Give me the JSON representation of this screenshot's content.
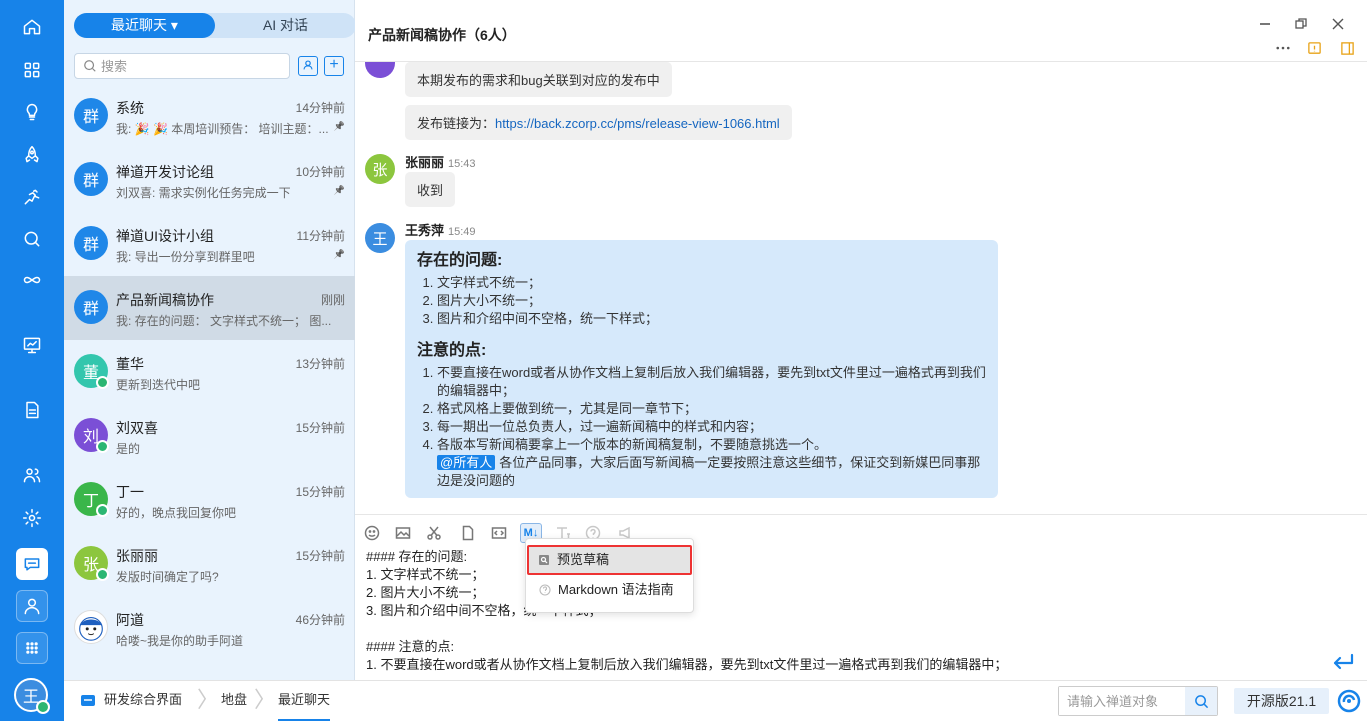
{
  "rail": {
    "items": [
      "home-icon",
      "apps-grid-icon",
      "bulb-icon",
      "rocket-icon",
      "running-icon",
      "search-icon",
      "infinity-icon",
      "board-icon",
      "document-icon",
      "contacts-icon",
      "settings-icon",
      "chat-icon",
      "user-icon",
      "more-apps-icon"
    ],
    "active": "chat-icon",
    "user_avatar": "王"
  },
  "list": {
    "tabs": [
      "最近聊天 ▾",
      "AI 对话"
    ],
    "active_tab": 0,
    "search_placeholder": "搜索",
    "conversations": [
      {
        "avatar": "群",
        "color": "#1f87e8",
        "name": "系统",
        "time": "14分钟前",
        "preview": "我: 🎉 🎉 本周培训预告： 培训主题：...",
        "pinned": true,
        "online": false
      },
      {
        "avatar": "群",
        "color": "#1f87e8",
        "name": "禅道开发讨论组",
        "time": "10分钟前",
        "preview": "刘双喜: 需求实例化任务完成一下",
        "pinned": true,
        "online": false
      },
      {
        "avatar": "群",
        "color": "#1f87e8",
        "name": "禅道UI设计小组",
        "time": "11分钟前",
        "preview": "我: 导出一份分享到群里吧",
        "pinned": true,
        "online": false
      },
      {
        "avatar": "群",
        "color": "#1f87e8",
        "name": "产品新闻稿协作",
        "time": "刚刚",
        "preview": "我: 存在的问题： 文字样式不统一； 图...",
        "pinned": false,
        "online": false,
        "selected": true
      },
      {
        "avatar": "董",
        "color": "#33c6ad",
        "name": "董华",
        "time": "13分钟前",
        "preview": "更新到迭代中吧",
        "pinned": false,
        "online": true
      },
      {
        "avatar": "刘",
        "color": "#7b4fd6",
        "name": "刘双喜",
        "time": "15分钟前",
        "preview": "是的",
        "pinned": false,
        "online": true
      },
      {
        "avatar": "丁",
        "color": "#3ab64a",
        "name": "丁一",
        "time": "15分钟前",
        "preview": "好的，晚点我回复你吧",
        "pinned": false,
        "online": true
      },
      {
        "avatar": "张",
        "color": "#8cc63e",
        "name": "张丽丽",
        "time": "15分钟前",
        "preview": "发版时间确定了吗?",
        "pinned": false,
        "online": true
      },
      {
        "avatar": "",
        "color": "#ffffff",
        "name": "阿道",
        "time": "46分钟前",
        "preview": "哈喽~我是你的助手阿道",
        "pinned": false,
        "online": false,
        "robot": true
      }
    ]
  },
  "header": {
    "title": "产品新闻稿协作（6人）"
  },
  "messages": {
    "m1": "本期发布的需求和bug关联到对应的发布中",
    "m2_prefix": "发布链接为：",
    "m2_link": "https://back.zcorp.cc/pms/release-view-1066.html",
    "m3_sender": "张丽丽",
    "m3_time": "15:43",
    "m3_avatar": "张",
    "m3_text": "收到",
    "m4_sender": "王秀萍",
    "m4_time": "15:49",
    "m4_avatar": "王",
    "md_h1": "存在的问题:",
    "md_list1": [
      "文字样式不统一；",
      "图片大小不统一；",
      "图片和介绍中间不空格，统一下样式；"
    ],
    "md_h2": "注意的点:",
    "md_list2": [
      "不要直接在word或者从协作文档上复制后放入我们编辑器，要先到txt文件里过一遍格式再到我们的编辑器中；",
      "格式风格上要做到统一，尤其是同一章节下；",
      "每一期出一位总负责人，过一遍新闻稿中的样式和内容；",
      "各版本写新闻稿要拿上一个版本的新闻稿复制，不要随意挑选一个。"
    ],
    "mention": "@所有人",
    "mention_text": "各位产品同事，大家后面写新闻稿一定要按照注意这些细节，保证交到新媒巴同事那边是没问题的"
  },
  "toolbar": {
    "icons": [
      "emoji-icon",
      "image-icon",
      "scissors-icon",
      "file-icon",
      "code-icon",
      "markdown-icon",
      "text-format-icon",
      "help-icon",
      "megaphone-icon"
    ],
    "markdown_label": "M↓"
  },
  "popup": {
    "preview": "预览草稿",
    "guide": "Markdown 语法指南"
  },
  "editor": {
    "text": "#### 存在的问题:\n1. 文字样式不统一；\n2. 图片大小不统一；\n3. 图片和介绍中间不空格，统一下样式；\n\n#### 注意的点:\n1. 不要直接在word或者从协作文档上复制后放入我们编辑器，要先到txt文件里过一遍格式再到我们的编辑器中；"
  },
  "bottom": {
    "crumb1": "研发综合界面",
    "crumb2": "地盘",
    "crumb3": "最近聊天",
    "search_placeholder": "请输入禅道对象",
    "version": "开源版21.1"
  },
  "colors": {
    "brand": "#1783e9",
    "sidebar": "#1783e9",
    "md_bubble": "#d6e9fb",
    "online": "#2bb673"
  }
}
